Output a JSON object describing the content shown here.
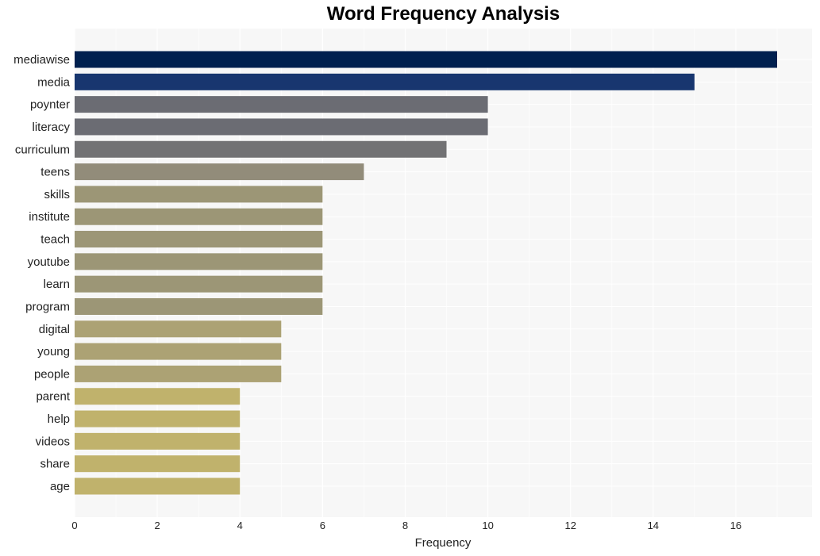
{
  "chart_data": {
    "type": "bar",
    "orientation": "horizontal",
    "title": "Word Frequency Analysis",
    "xlabel": "Frequency",
    "ylabel": "",
    "xlim": [
      0,
      17.8
    ],
    "xticks": [
      0,
      2,
      4,
      6,
      8,
      10,
      12,
      14,
      16
    ],
    "grid": true,
    "legend": "none",
    "categories": [
      "mediawise",
      "media",
      "poynter",
      "literacy",
      "curriculum",
      "teens",
      "skills",
      "institute",
      "teach",
      "youtube",
      "learn",
      "program",
      "digital",
      "young",
      "people",
      "parent",
      "help",
      "videos",
      "share",
      "age"
    ],
    "values": [
      17,
      15,
      10,
      10,
      9,
      7,
      6,
      6,
      6,
      6,
      6,
      6,
      5,
      5,
      5,
      4,
      4,
      4,
      4,
      4
    ],
    "colors": [
      "#00204f",
      "#18366f",
      "#6b6c73",
      "#6b6c73",
      "#727274",
      "#928c7a",
      "#9c9676",
      "#9c9676",
      "#9c9676",
      "#9c9676",
      "#9c9676",
      "#9c9676",
      "#aca274",
      "#aca274",
      "#aca274",
      "#c0b26c",
      "#c0b26c",
      "#c0b26c",
      "#c0b26c",
      "#c0b26c"
    ]
  }
}
